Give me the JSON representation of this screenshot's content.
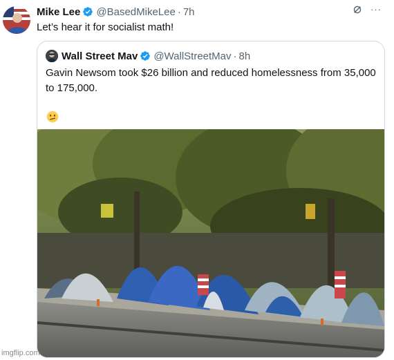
{
  "author": {
    "name": "Mike Lee",
    "handle": "@BasedMikeLee",
    "separator": "·",
    "time": "7h",
    "text": "Let’s hear it for socialist math!"
  },
  "quoted": {
    "name": "Wall Street Mav",
    "handle": "@WallStreetMav",
    "separator": "·",
    "time": "8h",
    "text": "Gavin Newsom took $26 billion and reduced homelessness from 35,000 to 175,000.",
    "emoji": "face-with-diagonal-mouth"
  },
  "icons": {
    "verified_color": "#1d9bf0",
    "more": "···",
    "grok": "grok-icon"
  },
  "watermark": "imgflip.com"
}
